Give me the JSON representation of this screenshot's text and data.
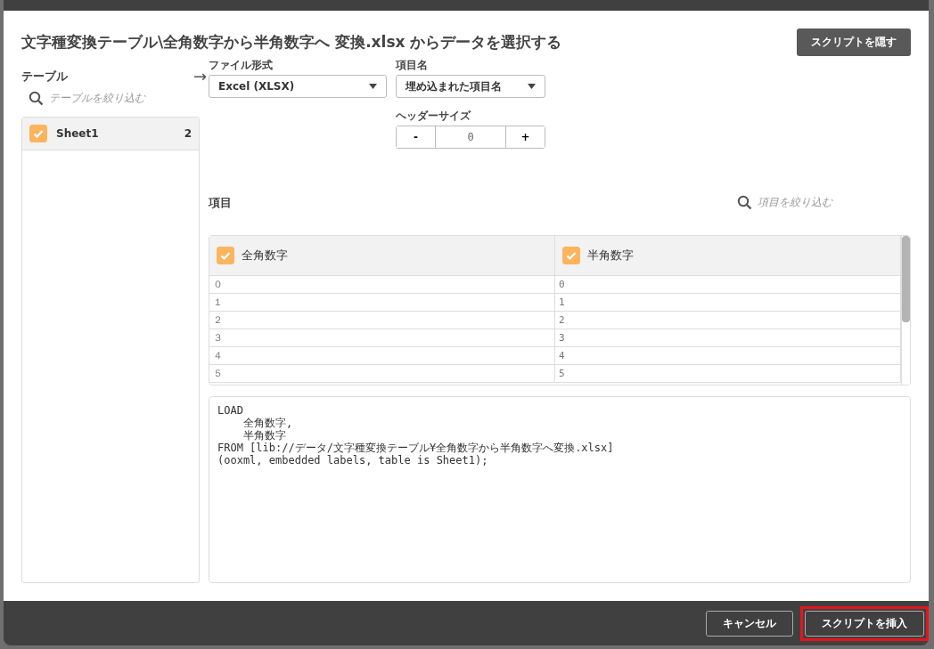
{
  "dialog": {
    "title": "文字種変換テーブル**\\**全角数字から半角数字へ 変換**.xlsx** からデータを選択する",
    "hide_script_button": "スクリプトを隠す"
  },
  "tables_panel": {
    "heading": "テーブル",
    "arrow": "→",
    "search_placeholder": "テーブルを絞り込む",
    "items": [
      {
        "name": "Sheet1",
        "count": "2",
        "checked": true,
        "selected": true
      }
    ]
  },
  "options": {
    "file_format": {
      "label": "ファイル形式",
      "value": "Excel (XLSX)"
    },
    "field_names": {
      "label": "項目名",
      "value": "埋め込まれた項目名"
    },
    "header_size": {
      "label": "ヘッダーサイズ",
      "minus": "-",
      "value": "0",
      "plus": "+"
    }
  },
  "fields": {
    "heading": "項目",
    "search_placeholder": "項目を絞り込む",
    "columns": [
      {
        "name": "全角数字",
        "checked": true
      },
      {
        "name": "半角数字",
        "checked": true
      }
    ],
    "rows": [
      [
        "０",
        "0"
      ],
      [
        "１",
        "1"
      ],
      [
        "２",
        "2"
      ],
      [
        "３",
        "3"
      ],
      [
        "４",
        "4"
      ],
      [
        "５",
        "5"
      ]
    ]
  },
  "script": [
    "LOAD",
    "    全角数字,",
    "    半角数字",
    "FROM [lib://データ/文字種変換テーブル¥全角数字から半角数字へ変換.xlsx]",
    "(ooxml, embedded labels, table is Sheet1);"
  ],
  "footer": {
    "buttons": [
      {
        "label": "キャンセル",
        "highlighted": false
      },
      {
        "label": "スクリプトを挿入",
        "highlighted": true
      }
    ]
  }
}
